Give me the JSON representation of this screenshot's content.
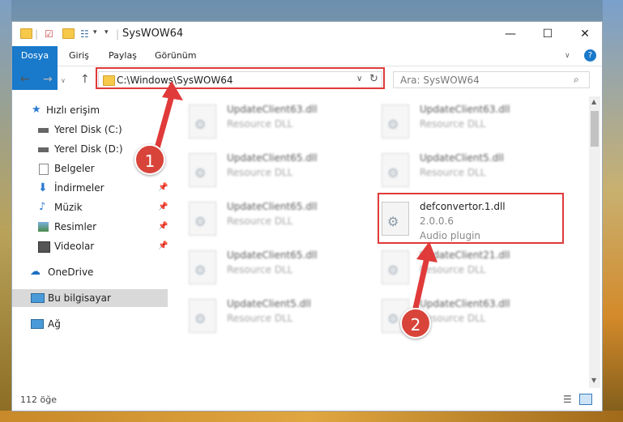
{
  "window": {
    "title": "SysWOW64"
  },
  "ribbon": {
    "tabs": [
      "Dosya",
      "Giriş",
      "Paylaş",
      "Görünüm"
    ]
  },
  "address": {
    "path": "C:\\Windows\\SysWOW64"
  },
  "search": {
    "placeholder": "Ara: SysWOW64"
  },
  "nav": {
    "items": [
      {
        "label": "Hızlı erişim"
      },
      {
        "label": "Yerel Disk (C:)"
      },
      {
        "label": "Yerel Disk (D:)"
      },
      {
        "label": "Belgeler"
      },
      {
        "label": "İndirmeler"
      },
      {
        "label": "Müzik"
      },
      {
        "label": "Resimler"
      },
      {
        "label": "Videolar"
      },
      {
        "label": "OneDrive"
      },
      {
        "label": "Bu bilgisayar"
      },
      {
        "label": "Ağ"
      }
    ]
  },
  "files": [
    {
      "name": "UpdateClient63.dll",
      "line2": "Resource DLL"
    },
    {
      "name": "UpdateClient63.dll",
      "line2": "Resource DLL"
    },
    {
      "name": "UpdateClient65.dll",
      "line2": "Resource DLL"
    },
    {
      "name": "UpdateClient5.dll",
      "line2": "Resource DLL"
    },
    {
      "name": "UpdateClient65.dll",
      "line2": "Resource DLL"
    },
    {
      "name": "defconvertor.1.dll",
      "line2": "2.0.0.6",
      "line3": "Audio plugin"
    },
    {
      "name": "UpdateClient65.dll",
      "line2": "Resource DLL"
    },
    {
      "name": "UpdateClient21.dll",
      "line2": "Resource DLL"
    },
    {
      "name": "UpdateClient5.dll",
      "line2": "Resource DLL"
    },
    {
      "name": "UpdateClient63.dll",
      "line2": "Resource DLL"
    }
  ],
  "status": {
    "count": "112 öğe"
  },
  "annotations": {
    "step1": "1",
    "step2": "2"
  },
  "colors": {
    "highlight": "#e03a3a",
    "accent": "#1979ca"
  }
}
